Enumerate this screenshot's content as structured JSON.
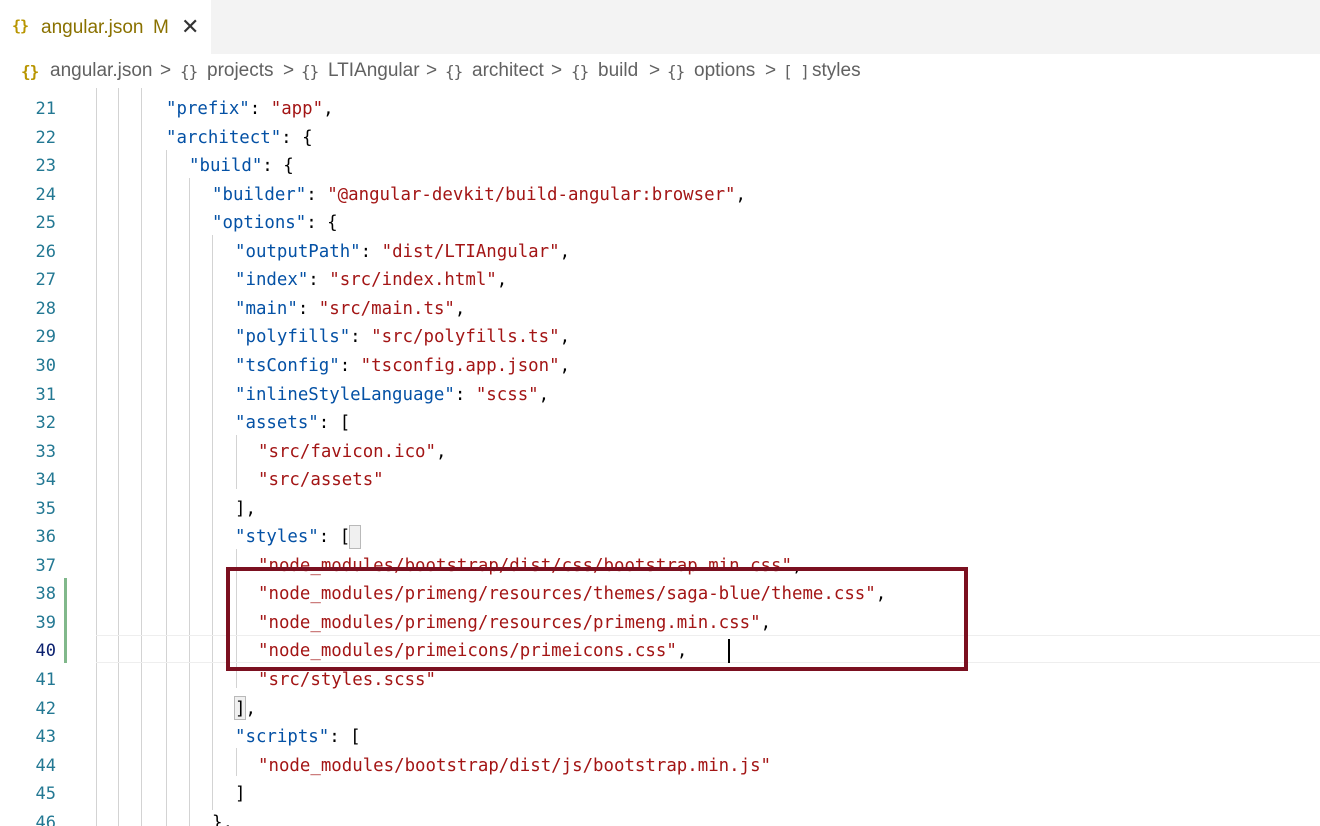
{
  "tab": {
    "icon": "json-braces-icon",
    "icon_glyph": "{}",
    "filename": "angular.json",
    "modified": "M",
    "close": "✕"
  },
  "breadcrumb": {
    "separator": ">",
    "items": [
      {
        "glyph": "{}",
        "label": "angular.json"
      },
      {
        "glyph": "{}",
        "label": "projects"
      },
      {
        "glyph": "{}",
        "label": "LTIAngular"
      },
      {
        "glyph": "{}",
        "label": "architect"
      },
      {
        "glyph": "{}",
        "label": "build"
      },
      {
        "glyph": "{}",
        "label": "options"
      },
      {
        "glyph": "[ ]",
        "label": "styles"
      }
    ]
  },
  "colors": {
    "key": "#0451a5",
    "string": "#a31515",
    "line_number": "#237893",
    "highlight_box": "#7b1020",
    "git_added": "#81b88b"
  },
  "active_line": 40,
  "lines": [
    {
      "n": "21",
      "segs": [
        {
          "t": "\"prefix\"",
          "c": "k"
        },
        {
          "t": ": ",
          "c": "p"
        },
        {
          "t": "\"app\"",
          "c": "s"
        },
        {
          "t": ",",
          "c": "p"
        }
      ]
    },
    {
      "n": "22",
      "segs": [
        {
          "t": "\"architect\"",
          "c": "k"
        },
        {
          "t": ": {",
          "c": "p"
        }
      ]
    },
    {
      "n": "23",
      "segs": [
        {
          "t": "\"build\"",
          "c": "k"
        },
        {
          "t": ": {",
          "c": "p"
        }
      ]
    },
    {
      "n": "24",
      "segs": [
        {
          "t": "\"builder\"",
          "c": "k"
        },
        {
          "t": ": ",
          "c": "p"
        },
        {
          "t": "\"@angular-devkit/build-angular:browser\"",
          "c": "s"
        },
        {
          "t": ",",
          "c": "p"
        }
      ]
    },
    {
      "n": "25",
      "segs": [
        {
          "t": "\"options\"",
          "c": "k"
        },
        {
          "t": ": {",
          "c": "p"
        }
      ]
    },
    {
      "n": "26",
      "segs": [
        {
          "t": "\"outputPath\"",
          "c": "k"
        },
        {
          "t": ": ",
          "c": "p"
        },
        {
          "t": "\"dist/LTIAngular\"",
          "c": "s"
        },
        {
          "t": ",",
          "c": "p"
        }
      ]
    },
    {
      "n": "27",
      "segs": [
        {
          "t": "\"index\"",
          "c": "k"
        },
        {
          "t": ": ",
          "c": "p"
        },
        {
          "t": "\"src/index.html\"",
          "c": "s"
        },
        {
          "t": ",",
          "c": "p"
        }
      ]
    },
    {
      "n": "28",
      "segs": [
        {
          "t": "\"main\"",
          "c": "k"
        },
        {
          "t": ": ",
          "c": "p"
        },
        {
          "t": "\"src/main.ts\"",
          "c": "s"
        },
        {
          "t": ",",
          "c": "p"
        }
      ]
    },
    {
      "n": "29",
      "segs": [
        {
          "t": "\"polyfills\"",
          "c": "k"
        },
        {
          "t": ": ",
          "c": "p"
        },
        {
          "t": "\"src/polyfills.ts\"",
          "c": "s"
        },
        {
          "t": ",",
          "c": "p"
        }
      ]
    },
    {
      "n": "30",
      "segs": [
        {
          "t": "\"tsConfig\"",
          "c": "k"
        },
        {
          "t": ": ",
          "c": "p"
        },
        {
          "t": "\"tsconfig.app.json\"",
          "c": "s"
        },
        {
          "t": ",",
          "c": "p"
        }
      ]
    },
    {
      "n": "31",
      "segs": [
        {
          "t": "\"inlineStyleLanguage\"",
          "c": "k"
        },
        {
          "t": ": ",
          "c": "p"
        },
        {
          "t": "\"scss\"",
          "c": "s"
        },
        {
          "t": ",",
          "c": "p"
        }
      ]
    },
    {
      "n": "32",
      "segs": [
        {
          "t": "\"assets\"",
          "c": "k"
        },
        {
          "t": ": [",
          "c": "p"
        }
      ]
    },
    {
      "n": "33",
      "segs": [
        {
          "t": "\"src/favicon.ico\"",
          "c": "s"
        },
        {
          "t": ",",
          "c": "p"
        }
      ]
    },
    {
      "n": "34",
      "segs": [
        {
          "t": "\"src/assets\"",
          "c": "s"
        }
      ]
    },
    {
      "n": "35",
      "segs": [
        {
          "t": "],",
          "c": "p"
        }
      ]
    },
    {
      "n": "36",
      "segs": [
        {
          "t": "\"styles\"",
          "c": "k"
        },
        {
          "t": ": [",
          "c": "p"
        }
      ]
    },
    {
      "n": "37",
      "segs": [
        {
          "t": "\"node_modules/bootstrap/dist/css/bootstrap.min.css\"",
          "c": "s"
        },
        {
          "t": ",",
          "c": "p"
        }
      ]
    },
    {
      "n": "38",
      "segs": [
        {
          "t": "\"node_modules/primeng/resources/themes/saga-blue/theme.css\"",
          "c": "s"
        },
        {
          "t": ",",
          "c": "p"
        }
      ]
    },
    {
      "n": "39",
      "segs": [
        {
          "t": "\"node_modules/primeng/resources/primeng.min.css\"",
          "c": "s"
        },
        {
          "t": ",",
          "c": "p"
        }
      ]
    },
    {
      "n": "40",
      "segs": [
        {
          "t": "\"node_modules/primeicons/primeicons.css\"",
          "c": "s"
        },
        {
          "t": ",",
          "c": "p"
        }
      ]
    },
    {
      "n": "41",
      "segs": [
        {
          "t": "\"src/styles.scss\"",
          "c": "s"
        }
      ]
    },
    {
      "n": "42",
      "segs": [
        {
          "t": "],",
          "c": "p"
        }
      ]
    },
    {
      "n": "43",
      "segs": [
        {
          "t": "\"scripts\"",
          "c": "k"
        },
        {
          "t": ": [",
          "c": "p"
        }
      ]
    },
    {
      "n": "44",
      "segs": [
        {
          "t": "\"node_modules/bootstrap/dist/js/bootstrap.min.js\"",
          "c": "s"
        }
      ]
    },
    {
      "n": "45",
      "segs": [
        {
          "t": "]",
          "c": "p"
        }
      ]
    },
    {
      "n": "46",
      "segs": [
        {
          "t": "},",
          "c": "p"
        }
      ]
    }
  ]
}
